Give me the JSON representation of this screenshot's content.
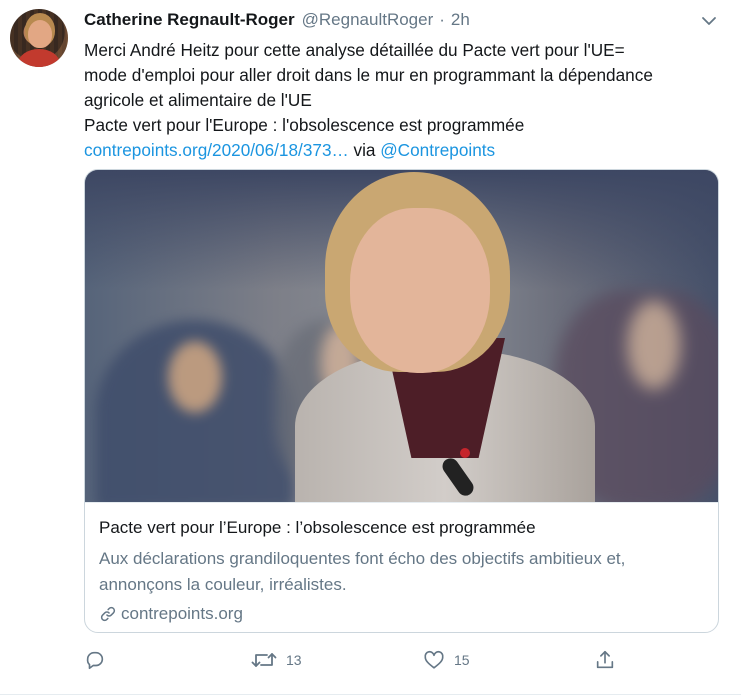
{
  "author": {
    "name": "Catherine Regnault-Roger",
    "handle": "@RegnaultRoger",
    "separator": "·",
    "time": "2h"
  },
  "tweet": {
    "line1": "Merci André Heitz pour cette analyse détaillée du Pacte vert pour l'UE=",
    "line2": "mode d'emploi pour aller droit dans le mur en programmant la dépendance",
    "line3": "agricole et alimentaire de l'UE",
    "line4": "Pacte vert pour l'Europe : l'obsolescence est programmée",
    "link_text": "contrepoints.org/2020/06/18/373…",
    "via": "via",
    "mention": "@Contrepoints"
  },
  "card": {
    "title": "Pacte vert pour l’Europe : l’obsolescence est programmée",
    "description_line1": "Aux déclarations grandiloquentes font écho des objectifs ambitieux et,",
    "description_line2": "annonçons la couleur, irréalistes.",
    "domain": "contrepoints.org"
  },
  "actions": {
    "reply_count": "",
    "retweet_count": "13",
    "like_count": "15"
  },
  "icons": {
    "caret": "chevron-down-icon",
    "reply": "reply-icon",
    "retweet": "retweet-icon",
    "like": "heart-icon",
    "share": "share-icon",
    "link": "link-icon"
  },
  "colors": {
    "link": "#1b95e0",
    "secondary_text": "#657786",
    "primary_text": "#14171a",
    "border": "#ccd6dd"
  }
}
